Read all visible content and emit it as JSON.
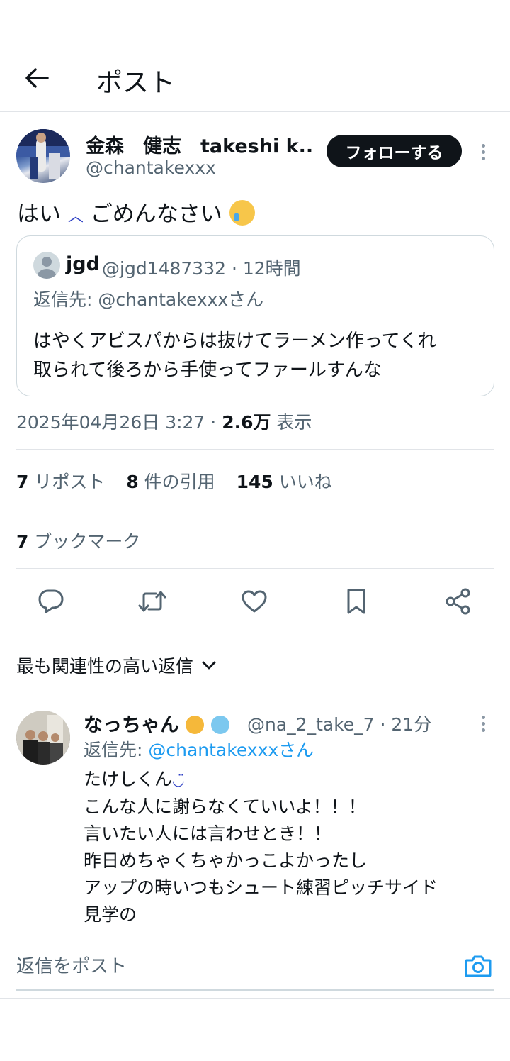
{
  "header": {
    "title": "ポスト"
  },
  "post": {
    "author_name": "金森　健志　takeshi k...",
    "author_handle": "@chantakexxx",
    "follow_label": "フォローする",
    "text_before": "はい",
    "sad_emoji": "︿",
    "text_after": "ごめんなさい",
    "timestamp": "2025年04月26日 3:27 · ",
    "views_count": "2.6万",
    "views_label": " 表示"
  },
  "quote": {
    "name": "jgd",
    "meta": "@jgd1487332 · 12時間",
    "reply_to": "返信先: @chantakexxxさん",
    "line1": "はやくアビスパからは抜けてラーメン作ってくれ",
    "line2": "取られて後ろから手使ってファールすんな"
  },
  "stats": {
    "reposts_count": "7",
    "reposts_label": " リポスト",
    "quotes_count": "8",
    "quotes_label": " 件の引用",
    "likes_count": "145",
    "likes_label": " いいね",
    "bookmarks_count": "7",
    "bookmarks_label": " ブックマーク"
  },
  "actions": [
    "reply-icon",
    "repost-icon",
    "like-icon",
    "bookmark-icon",
    "share-icon"
  ],
  "sort": {
    "label": "最も関連性の高い返信"
  },
  "reply": {
    "name": "なっちゃん",
    "meta": "@na_2_take_7 · 21分",
    "reply_prefix": "返信先: ",
    "reply_mention": "@chantakexxxさん",
    "line1": "たけしくん",
    "line2": "こんな人に謝らなくていいよ！！！",
    "line3": "言いたい人には言わせとき！！",
    "line4": "昨日めちゃくちゃかっこよかったし",
    "line5": "アップの時いつもシュート練習ピッチサイド",
    "line6": "見学の"
  },
  "compose": {
    "placeholder": "返信をポスト"
  },
  "colors": {
    "text": "#0f1419",
    "secondary": "#536471",
    "accent": "#1d9bf0",
    "border": "#e1e4e8"
  }
}
